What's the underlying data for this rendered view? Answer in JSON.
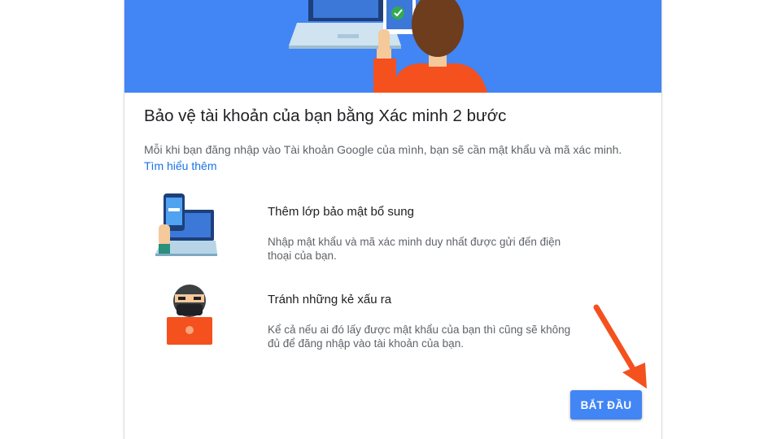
{
  "page": {
    "title": "Bảo vệ tài khoản của bạn bằng Xác minh 2 bước",
    "description": "Mỗi khi bạn đăng nhập vào Tài khoản Google của mình, bạn sẽ cần mật khẩu và mã xác minh.",
    "learn_more_link": "Tìm hiểu thêm"
  },
  "features": [
    {
      "icon": "phone-laptop-icon",
      "title": "Thêm lớp bảo mật bổ sung",
      "description": "Nhập mật khẩu và mã xác minh duy nhất được gửi đến điện thoại của bạn."
    },
    {
      "icon": "hacker-icon",
      "title": "Tránh những kẻ xấu ra",
      "description": "Kể cả nếu ai đó lấy được mật khẩu của bạn thì cũng sẽ không đủ để đăng nhập vào tài khoản của bạn."
    }
  ],
  "actions": {
    "start_label": "BẮT ĐẦU"
  },
  "colors": {
    "hero_background": "#4285f4",
    "primary_button": "#4285f4",
    "link": "#1a73e8",
    "annotation_arrow": "#f4511e"
  }
}
